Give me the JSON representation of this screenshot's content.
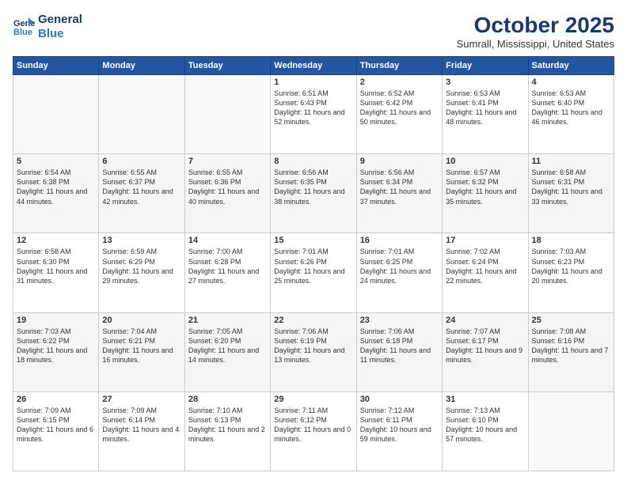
{
  "header": {
    "logo_line1": "General",
    "logo_line2": "Blue",
    "month": "October 2025",
    "location": "Sumrall, Mississippi, United States"
  },
  "days_of_week": [
    "Sunday",
    "Monday",
    "Tuesday",
    "Wednesday",
    "Thursday",
    "Friday",
    "Saturday"
  ],
  "weeks": [
    [
      {
        "day": "",
        "sunrise": "",
        "sunset": "",
        "daylight": ""
      },
      {
        "day": "",
        "sunrise": "",
        "sunset": "",
        "daylight": ""
      },
      {
        "day": "",
        "sunrise": "",
        "sunset": "",
        "daylight": ""
      },
      {
        "day": "1",
        "sunrise": "6:51 AM",
        "sunset": "6:43 PM",
        "daylight": "11 hours and 52 minutes."
      },
      {
        "day": "2",
        "sunrise": "6:52 AM",
        "sunset": "6:42 PM",
        "daylight": "11 hours and 50 minutes."
      },
      {
        "day": "3",
        "sunrise": "6:53 AM",
        "sunset": "6:41 PM",
        "daylight": "11 hours and 48 minutes."
      },
      {
        "day": "4",
        "sunrise": "6:53 AM",
        "sunset": "6:40 PM",
        "daylight": "11 hours and 46 minutes."
      }
    ],
    [
      {
        "day": "5",
        "sunrise": "6:54 AM",
        "sunset": "6:38 PM",
        "daylight": "11 hours and 44 minutes."
      },
      {
        "day": "6",
        "sunrise": "6:55 AM",
        "sunset": "6:37 PM",
        "daylight": "11 hours and 42 minutes."
      },
      {
        "day": "7",
        "sunrise": "6:55 AM",
        "sunset": "6:36 PM",
        "daylight": "11 hours and 40 minutes."
      },
      {
        "day": "8",
        "sunrise": "6:56 AM",
        "sunset": "6:35 PM",
        "daylight": "11 hours and 38 minutes."
      },
      {
        "day": "9",
        "sunrise": "6:56 AM",
        "sunset": "6:34 PM",
        "daylight": "11 hours and 37 minutes."
      },
      {
        "day": "10",
        "sunrise": "6:57 AM",
        "sunset": "6:32 PM",
        "daylight": "11 hours and 35 minutes."
      },
      {
        "day": "11",
        "sunrise": "6:58 AM",
        "sunset": "6:31 PM",
        "daylight": "11 hours and 33 minutes."
      }
    ],
    [
      {
        "day": "12",
        "sunrise": "6:58 AM",
        "sunset": "6:30 PM",
        "daylight": "11 hours and 31 minutes."
      },
      {
        "day": "13",
        "sunrise": "6:59 AM",
        "sunset": "6:29 PM",
        "daylight": "11 hours and 29 minutes."
      },
      {
        "day": "14",
        "sunrise": "7:00 AM",
        "sunset": "6:28 PM",
        "daylight": "11 hours and 27 minutes."
      },
      {
        "day": "15",
        "sunrise": "7:01 AM",
        "sunset": "6:26 PM",
        "daylight": "11 hours and 25 minutes."
      },
      {
        "day": "16",
        "sunrise": "7:01 AM",
        "sunset": "6:25 PM",
        "daylight": "11 hours and 24 minutes."
      },
      {
        "day": "17",
        "sunrise": "7:02 AM",
        "sunset": "6:24 PM",
        "daylight": "11 hours and 22 minutes."
      },
      {
        "day": "18",
        "sunrise": "7:03 AM",
        "sunset": "6:23 PM",
        "daylight": "11 hours and 20 minutes."
      }
    ],
    [
      {
        "day": "19",
        "sunrise": "7:03 AM",
        "sunset": "6:22 PM",
        "daylight": "11 hours and 18 minutes."
      },
      {
        "day": "20",
        "sunrise": "7:04 AM",
        "sunset": "6:21 PM",
        "daylight": "11 hours and 16 minutes."
      },
      {
        "day": "21",
        "sunrise": "7:05 AM",
        "sunset": "6:20 PM",
        "daylight": "11 hours and 14 minutes."
      },
      {
        "day": "22",
        "sunrise": "7:06 AM",
        "sunset": "6:19 PM",
        "daylight": "11 hours and 13 minutes."
      },
      {
        "day": "23",
        "sunrise": "7:06 AM",
        "sunset": "6:18 PM",
        "daylight": "11 hours and 11 minutes."
      },
      {
        "day": "24",
        "sunrise": "7:07 AM",
        "sunset": "6:17 PM",
        "daylight": "11 hours and 9 minutes."
      },
      {
        "day": "25",
        "sunrise": "7:08 AM",
        "sunset": "6:16 PM",
        "daylight": "11 hours and 7 minutes."
      }
    ],
    [
      {
        "day": "26",
        "sunrise": "7:09 AM",
        "sunset": "6:15 PM",
        "daylight": "11 hours and 6 minutes."
      },
      {
        "day": "27",
        "sunrise": "7:09 AM",
        "sunset": "6:14 PM",
        "daylight": "11 hours and 4 minutes."
      },
      {
        "day": "28",
        "sunrise": "7:10 AM",
        "sunset": "6:13 PM",
        "daylight": "11 hours and 2 minutes."
      },
      {
        "day": "29",
        "sunrise": "7:11 AM",
        "sunset": "6:12 PM",
        "daylight": "11 hours and 0 minutes."
      },
      {
        "day": "30",
        "sunrise": "7:12 AM",
        "sunset": "6:11 PM",
        "daylight": "10 hours and 59 minutes."
      },
      {
        "day": "31",
        "sunrise": "7:13 AM",
        "sunset": "6:10 PM",
        "daylight": "10 hours and 57 minutes."
      },
      {
        "day": "",
        "sunrise": "",
        "sunset": "",
        "daylight": ""
      }
    ]
  ]
}
